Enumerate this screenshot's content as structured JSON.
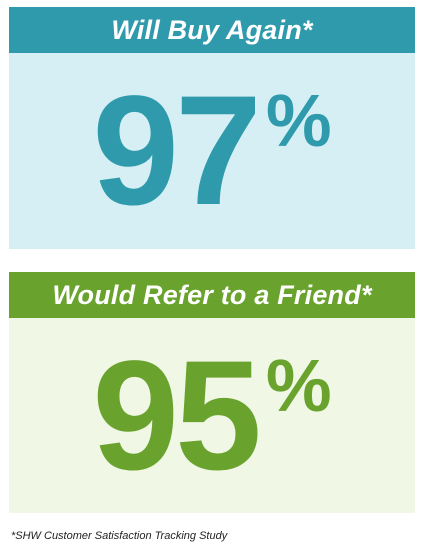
{
  "cards": [
    {
      "title": "Will Buy Again*",
      "value": "97",
      "unit": "%",
      "accent": "#2e9aab",
      "background": "#d6eff4"
    },
    {
      "title": "Would Refer to a Friend*",
      "value": "95",
      "unit": "%",
      "accent": "#69a32d",
      "background": "#f0f7e5"
    }
  ],
  "footnote": "*SHW Customer Satisfaction Tracking Study"
}
